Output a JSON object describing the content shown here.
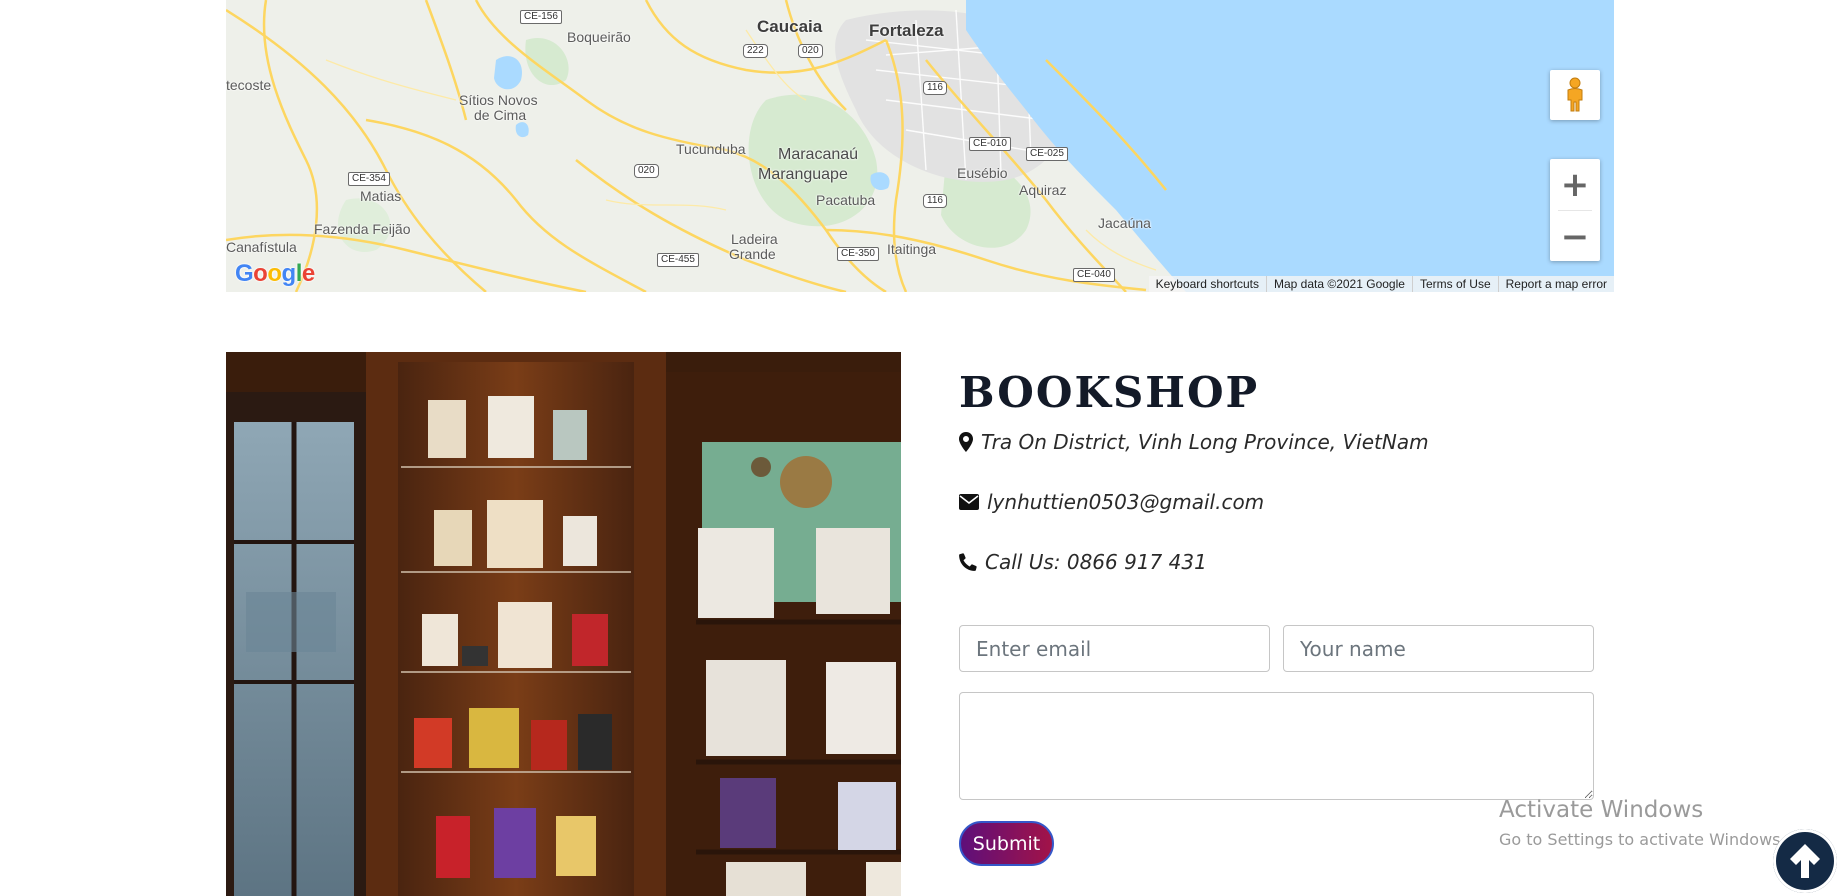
{
  "map": {
    "places": {
      "caucaia": "Caucaia",
      "fortaleza": "Fortaleza",
      "boqueirao": "Boqueirão",
      "itecoste": "tecoste",
      "sitios1": "Sítios Novos",
      "sitios2": "de Cima",
      "tucunduba": "Tucunduba",
      "maracanau": "Maracanaú",
      "maranguape": "Maranguape",
      "pacatuba": "Pacatuba",
      "eusebio": "Eusébio",
      "aquiraz": "Aquiraz",
      "jacauna": "Jacaúna",
      "matias": "Matias",
      "fazenda": "Fazenda Feijão",
      "canafistula": "Canafístula",
      "ladeira1": "Ladeira",
      "ladeira2": "Grande",
      "itaitinga": "Itaitinga"
    },
    "shields": {
      "ce156": "CE-156",
      "r222": "222",
      "r020a": "020",
      "r116a": "116",
      "ce010": "CE-010",
      "ce025": "CE-025",
      "ce354": "CE-354",
      "r020b": "020",
      "r116b": "116",
      "ce455": "CE-455",
      "ce350": "CE-350",
      "ce040": "CE-040"
    },
    "zoom_in": "+",
    "zoom_out": "−",
    "logo": {
      "text": "Google",
      "colors": [
        "#4285F4",
        "#EA4335",
        "#FBBC05",
        "#4285F4",
        "#34A853",
        "#EA4335"
      ]
    },
    "footer": {
      "shortcuts": "Keyboard shortcuts",
      "data": "Map data ©2021 Google",
      "terms": "Terms of Use",
      "report": "Report a map error"
    },
    "colors": {
      "water": "#aadaff",
      "land": "#eef0ea",
      "road": "#fdd660",
      "park": "#cfe7c4"
    }
  },
  "shop": {
    "title": "BOOKSHOP",
    "address": "Tra On District, Vinh Long Province, VietNam",
    "email": "lynhuttien0503@gmail.com",
    "phone": "Call Us: 0866 917 431",
    "icons": [
      "map-marker-icon",
      "envelope-icon",
      "phone-icon"
    ]
  },
  "form": {
    "email_placeholder": "Enter email",
    "name_placeholder": "Your name",
    "message_value": "",
    "submit_label": "Submit"
  },
  "watermark": {
    "line1": "Activate Windows",
    "line2": "Go to Settings to activate Windows."
  },
  "colors": {
    "title": "#131a28",
    "submit_gradient_start": "#5e0f7a",
    "submit_gradient_end": "#a21348",
    "submit_border": "#3557c9",
    "to_top_bg": "#142a45"
  }
}
